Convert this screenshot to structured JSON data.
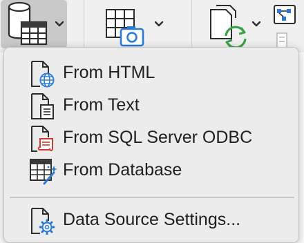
{
  "ribbon": {
    "buttons": [
      {
        "name": "get-data-button",
        "icon": "database-table-icon",
        "active": true
      },
      {
        "name": "from-picture-button",
        "icon": "table-camera-icon",
        "active": false
      },
      {
        "name": "refresh-all-button",
        "icon": "refresh-documents-icon",
        "active": false
      },
      {
        "name": "queries-connections-button",
        "icon": "queries-connections-icon",
        "active": false
      }
    ]
  },
  "menu": {
    "items": [
      {
        "label": "From HTML",
        "icon": "document-globe-icon"
      },
      {
        "label": "From Text",
        "icon": "document-text-icon"
      },
      {
        "label": "From SQL Server ODBC",
        "icon": "document-scroll-icon"
      },
      {
        "label": "From Database",
        "icon": "database-wand-icon"
      },
      {
        "label": "Data Source Settings...",
        "icon": "document-gear-icon"
      }
    ]
  },
  "colors": {
    "accent_blue": "#2a7ad6",
    "accent_green": "#3aa046",
    "accent_red": "#d23a2c",
    "menu_bg": "#ececec",
    "ribbon_bg": "#f0f0f0"
  }
}
